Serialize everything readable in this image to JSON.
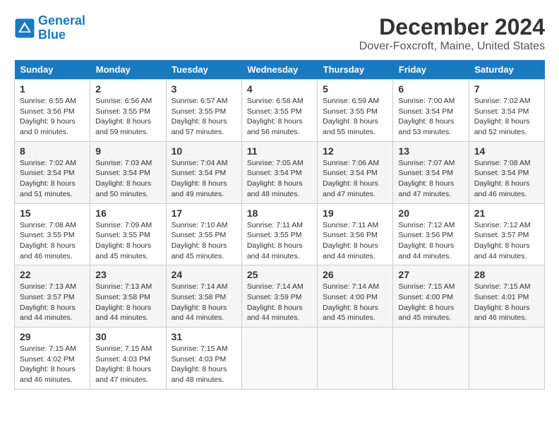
{
  "logo": {
    "line1": "General",
    "line2": "Blue"
  },
  "title": "December 2024",
  "subtitle": "Dover-Foxcroft, Maine, United States",
  "headers": [
    "Sunday",
    "Monday",
    "Tuesday",
    "Wednesday",
    "Thursday",
    "Friday",
    "Saturday"
  ],
  "weeks": [
    [
      {
        "day": "1",
        "sunrise": "Sunrise: 6:55 AM",
        "sunset": "Sunset: 3:56 PM",
        "daylight": "Daylight: 9 hours and 0 minutes."
      },
      {
        "day": "2",
        "sunrise": "Sunrise: 6:56 AM",
        "sunset": "Sunset: 3:55 PM",
        "daylight": "Daylight: 8 hours and 59 minutes."
      },
      {
        "day": "3",
        "sunrise": "Sunrise: 6:57 AM",
        "sunset": "Sunset: 3:55 PM",
        "daylight": "Daylight: 8 hours and 57 minutes."
      },
      {
        "day": "4",
        "sunrise": "Sunrise: 6:58 AM",
        "sunset": "Sunset: 3:55 PM",
        "daylight": "Daylight: 8 hours and 56 minutes."
      },
      {
        "day": "5",
        "sunrise": "Sunrise: 6:59 AM",
        "sunset": "Sunset: 3:55 PM",
        "daylight": "Daylight: 8 hours and 55 minutes."
      },
      {
        "day": "6",
        "sunrise": "Sunrise: 7:00 AM",
        "sunset": "Sunset: 3:54 PM",
        "daylight": "Daylight: 8 hours and 53 minutes."
      },
      {
        "day": "7",
        "sunrise": "Sunrise: 7:02 AM",
        "sunset": "Sunset: 3:54 PM",
        "daylight": "Daylight: 8 hours and 52 minutes."
      }
    ],
    [
      {
        "day": "8",
        "sunrise": "Sunrise: 7:02 AM",
        "sunset": "Sunset: 3:54 PM",
        "daylight": "Daylight: 8 hours and 51 minutes."
      },
      {
        "day": "9",
        "sunrise": "Sunrise: 7:03 AM",
        "sunset": "Sunset: 3:54 PM",
        "daylight": "Daylight: 8 hours and 50 minutes."
      },
      {
        "day": "10",
        "sunrise": "Sunrise: 7:04 AM",
        "sunset": "Sunset: 3:54 PM",
        "daylight": "Daylight: 8 hours and 49 minutes."
      },
      {
        "day": "11",
        "sunrise": "Sunrise: 7:05 AM",
        "sunset": "Sunset: 3:54 PM",
        "daylight": "Daylight: 8 hours and 48 minutes."
      },
      {
        "day": "12",
        "sunrise": "Sunrise: 7:06 AM",
        "sunset": "Sunset: 3:54 PM",
        "daylight": "Daylight: 8 hours and 47 minutes."
      },
      {
        "day": "13",
        "sunrise": "Sunrise: 7:07 AM",
        "sunset": "Sunset: 3:54 PM",
        "daylight": "Daylight: 8 hours and 47 minutes."
      },
      {
        "day": "14",
        "sunrise": "Sunrise: 7:08 AM",
        "sunset": "Sunset: 3:54 PM",
        "daylight": "Daylight: 8 hours and 46 minutes."
      }
    ],
    [
      {
        "day": "15",
        "sunrise": "Sunrise: 7:08 AM",
        "sunset": "Sunset: 3:55 PM",
        "daylight": "Daylight: 8 hours and 46 minutes."
      },
      {
        "day": "16",
        "sunrise": "Sunrise: 7:09 AM",
        "sunset": "Sunset: 3:55 PM",
        "daylight": "Daylight: 8 hours and 45 minutes."
      },
      {
        "day": "17",
        "sunrise": "Sunrise: 7:10 AM",
        "sunset": "Sunset: 3:55 PM",
        "daylight": "Daylight: 8 hours and 45 minutes."
      },
      {
        "day": "18",
        "sunrise": "Sunrise: 7:11 AM",
        "sunset": "Sunset: 3:55 PM",
        "daylight": "Daylight: 8 hours and 44 minutes."
      },
      {
        "day": "19",
        "sunrise": "Sunrise: 7:11 AM",
        "sunset": "Sunset: 3:56 PM",
        "daylight": "Daylight: 8 hours and 44 minutes."
      },
      {
        "day": "20",
        "sunrise": "Sunrise: 7:12 AM",
        "sunset": "Sunset: 3:56 PM",
        "daylight": "Daylight: 8 hours and 44 minutes."
      },
      {
        "day": "21",
        "sunrise": "Sunrise: 7:12 AM",
        "sunset": "Sunset: 3:57 PM",
        "daylight": "Daylight: 8 hours and 44 minutes."
      }
    ],
    [
      {
        "day": "22",
        "sunrise": "Sunrise: 7:13 AM",
        "sunset": "Sunset: 3:57 PM",
        "daylight": "Daylight: 8 hours and 44 minutes."
      },
      {
        "day": "23",
        "sunrise": "Sunrise: 7:13 AM",
        "sunset": "Sunset: 3:58 PM",
        "daylight": "Daylight: 8 hours and 44 minutes."
      },
      {
        "day": "24",
        "sunrise": "Sunrise: 7:14 AM",
        "sunset": "Sunset: 3:58 PM",
        "daylight": "Daylight: 8 hours and 44 minutes."
      },
      {
        "day": "25",
        "sunrise": "Sunrise: 7:14 AM",
        "sunset": "Sunset: 3:59 PM",
        "daylight": "Daylight: 8 hours and 44 minutes."
      },
      {
        "day": "26",
        "sunrise": "Sunrise: 7:14 AM",
        "sunset": "Sunset: 4:00 PM",
        "daylight": "Daylight: 8 hours and 45 minutes."
      },
      {
        "day": "27",
        "sunrise": "Sunrise: 7:15 AM",
        "sunset": "Sunset: 4:00 PM",
        "daylight": "Daylight: 8 hours and 45 minutes."
      },
      {
        "day": "28",
        "sunrise": "Sunrise: 7:15 AM",
        "sunset": "Sunset: 4:01 PM",
        "daylight": "Daylight: 8 hours and 46 minutes."
      }
    ],
    [
      {
        "day": "29",
        "sunrise": "Sunrise: 7:15 AM",
        "sunset": "Sunset: 4:02 PM",
        "daylight": "Daylight: 8 hours and 46 minutes."
      },
      {
        "day": "30",
        "sunrise": "Sunrise: 7:15 AM",
        "sunset": "Sunset: 4:03 PM",
        "daylight": "Daylight: 8 hours and 47 minutes."
      },
      {
        "day": "31",
        "sunrise": "Sunrise: 7:15 AM",
        "sunset": "Sunset: 4:03 PM",
        "daylight": "Daylight: 8 hours and 48 minutes."
      },
      null,
      null,
      null,
      null
    ]
  ]
}
